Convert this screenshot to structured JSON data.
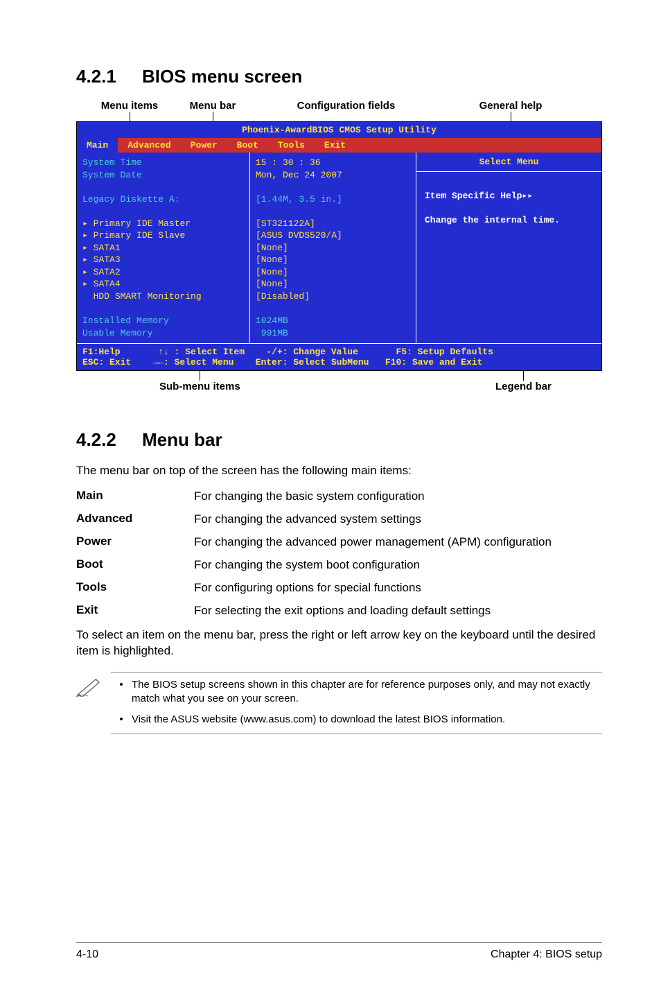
{
  "section1": {
    "num": "4.2.1",
    "title": "BIOS menu screen"
  },
  "diagram": {
    "top_labels": {
      "menu_items": "Menu items",
      "menu_bar": "Menu bar",
      "config_fields": "Configuration fields",
      "general_help": "General help"
    },
    "bottom_labels": {
      "submenu": "Sub-menu items",
      "legend": "Legend bar"
    },
    "title": "Phoenix-AwardBIOS CMOS Setup Utility",
    "menus": [
      "Main",
      "Advanced",
      "Power",
      "Boot",
      "Tools",
      "Exit"
    ],
    "left": {
      "l1": "System Time",
      "l2": "System Date",
      "l3": "Legacy Diskette A:",
      "sub": [
        "Primary IDE Master",
        "Primary IDE Slave",
        "SATA1",
        "SATA3",
        "SATA2",
        "SATA4",
        "HDD SMART Monitoring"
      ],
      "l4": "Installed Memory",
      "l5": "Usable Memory"
    },
    "mid": {
      "time": "15 : 30 : 36",
      "date": "Mon, Dec 24 2007",
      "legacy": "[1.44M, 3.5 in.]",
      "vals": [
        "[ST321122A]",
        "[ASUS DVDS520/A]",
        "[None]",
        "[None]",
        "[None]",
        "[None]",
        "[Disabled]"
      ],
      "mem1": "1024MB",
      "mem2": " 991MB"
    },
    "right": {
      "title": "Select Menu",
      "help": "Item Specific Help▸▸",
      "chg": "Change the internal time."
    },
    "legend1": "F1:Help       ↑↓ : Select Item    -/+: Change Value       F5: Setup Defaults",
    "legend2": "ESC: Exit    →←: Select Menu    Enter: Select SubMenu   F10: Save and Exit"
  },
  "section2": {
    "num": "4.2.2",
    "title": "Menu bar"
  },
  "intro2": "The menu bar on top of the screen has the following main items:",
  "defs": [
    {
      "k": "Main",
      "v": "For changing the basic system configuration"
    },
    {
      "k": "Advanced",
      "v": "For changing the advanced system settings"
    },
    {
      "k": "Power",
      "v": "For changing the advanced power management (APM) configuration"
    },
    {
      "k": "Boot",
      "v": "For changing the system boot configuration"
    },
    {
      "k": "Tools",
      "v": "For configuring options for special functions"
    },
    {
      "k": "Exit",
      "v": "For selecting the exit options and loading default settings"
    }
  ],
  "outro2": "To select an item on the menu bar, press the right or left arrow key on the keyboard until the desired item is highlighted.",
  "notes": [
    "The BIOS setup screens shown in this chapter are for reference purposes only, and may not exactly match what you see on your screen.",
    "Visit the ASUS website (www.asus.com) to download the latest BIOS information."
  ],
  "footer": {
    "left": "4-10",
    "right": "Chapter 4: BIOS setup"
  }
}
